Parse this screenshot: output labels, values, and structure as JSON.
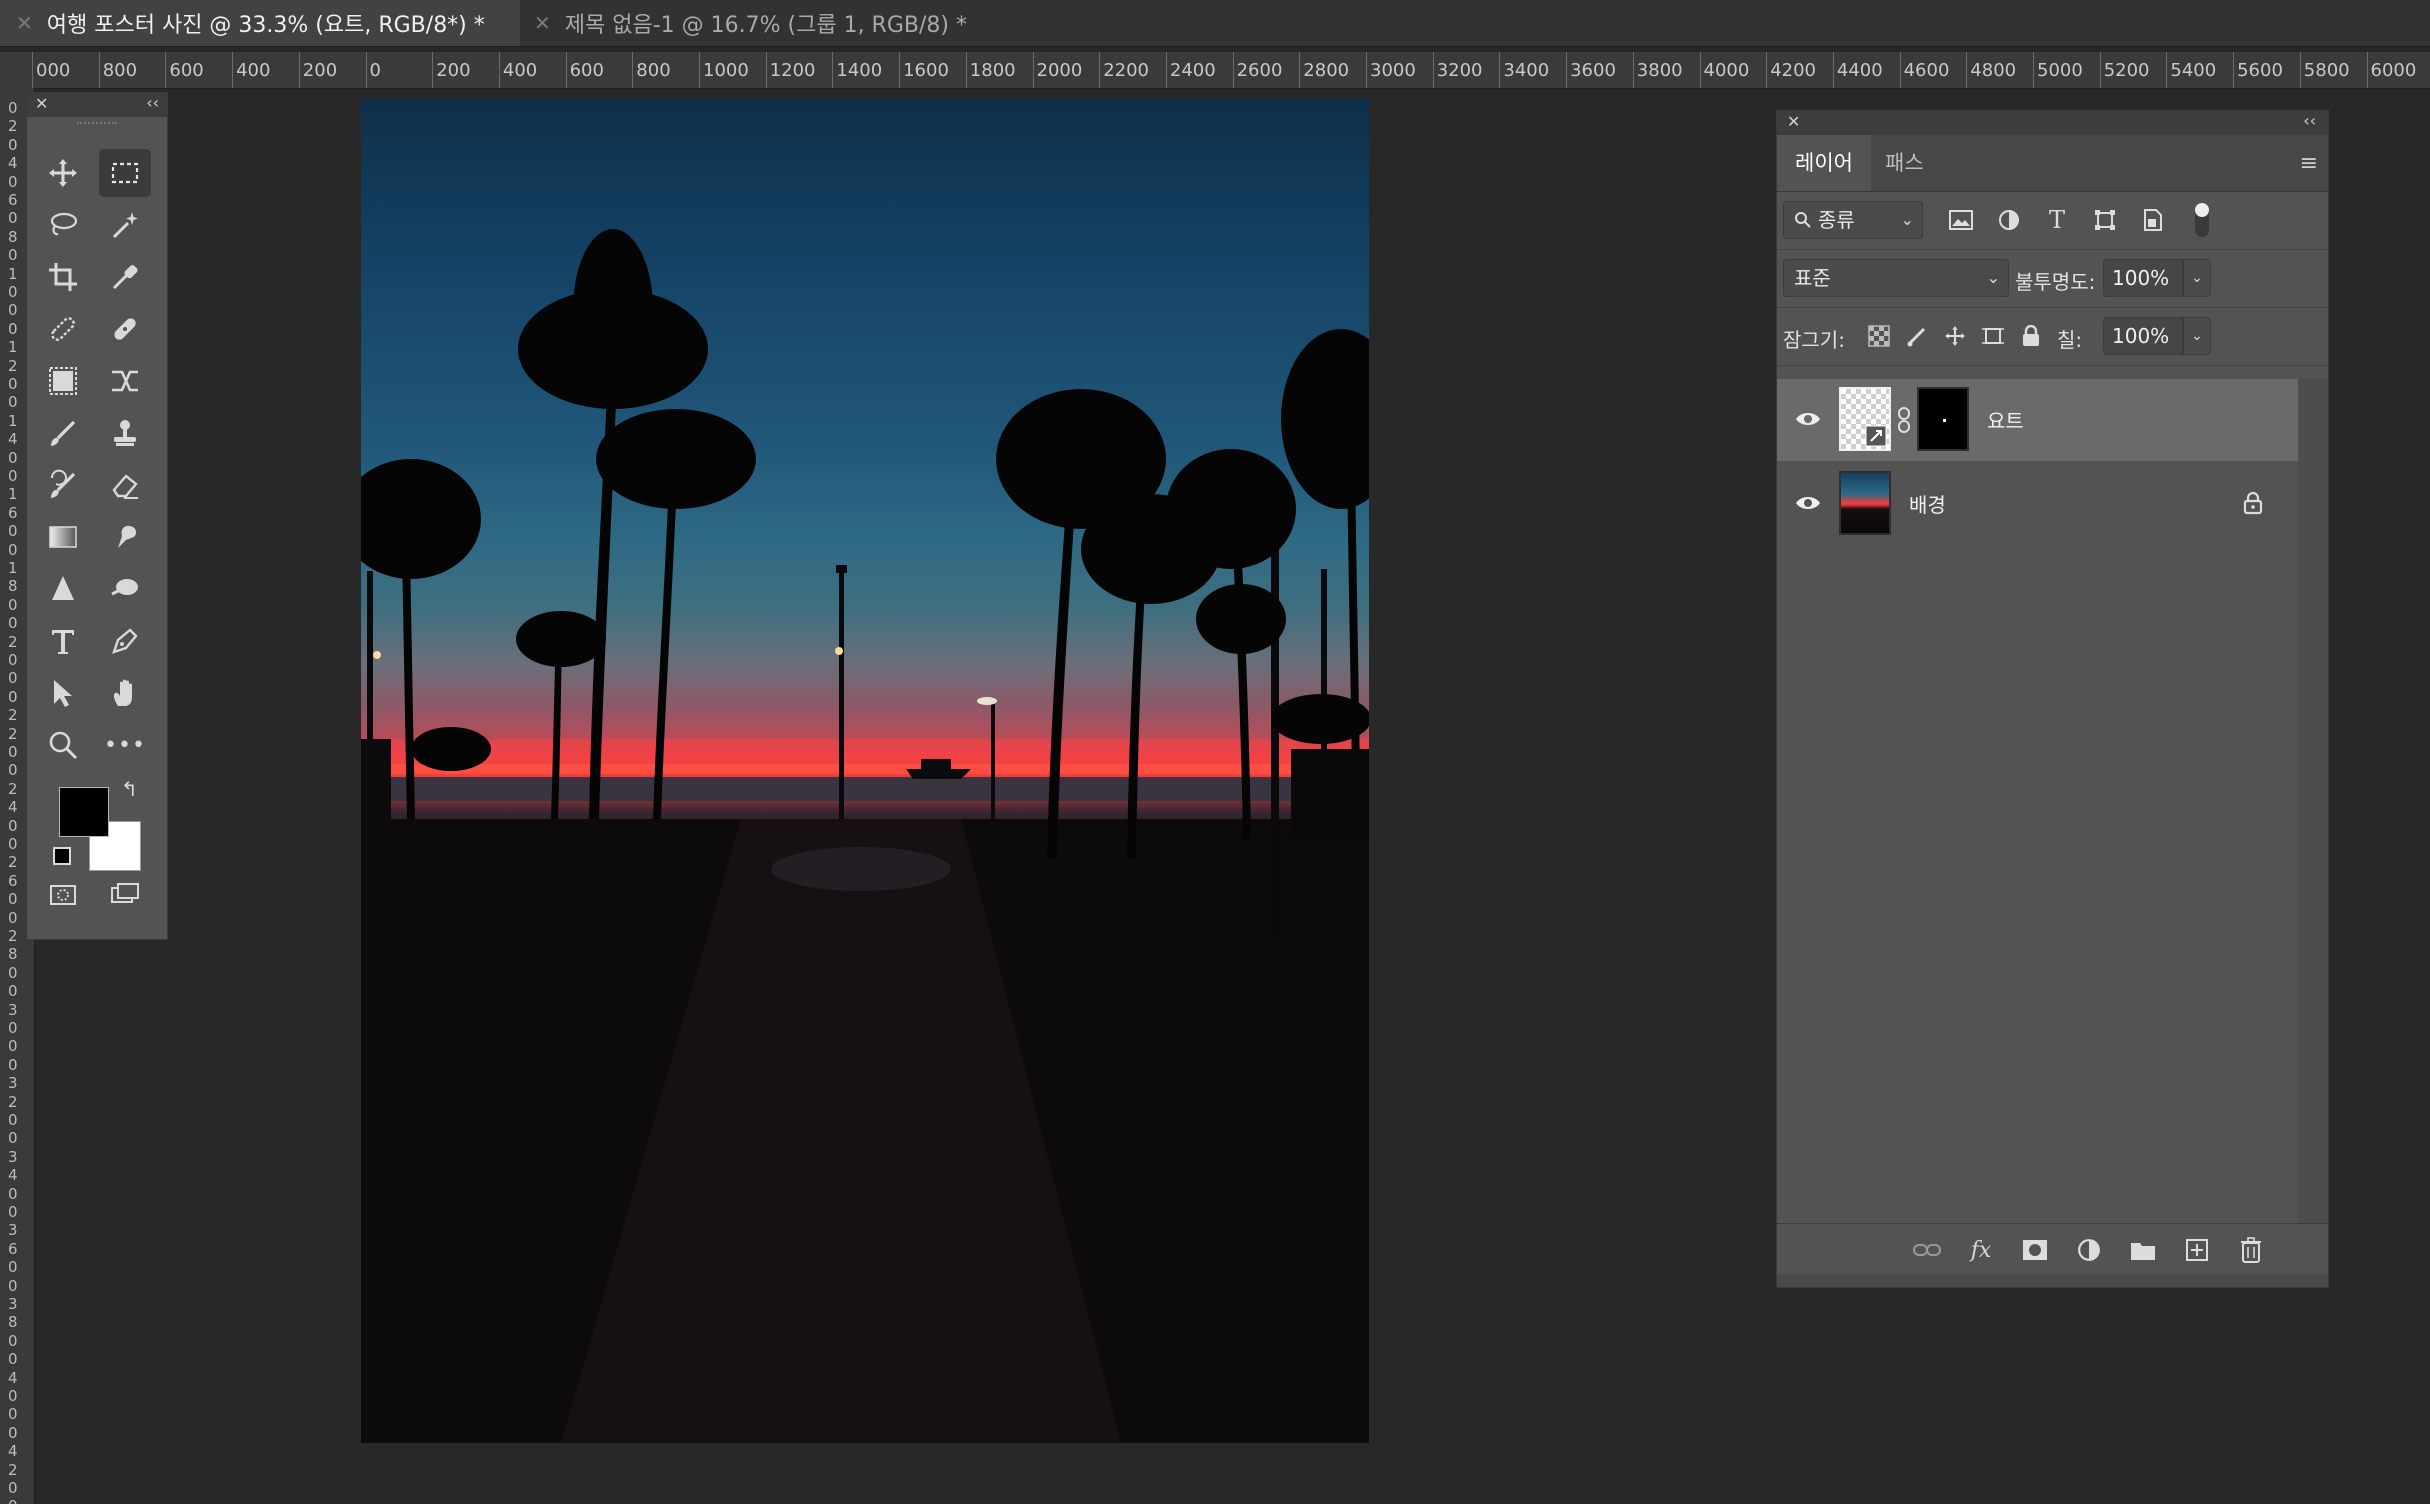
{
  "tabs": [
    {
      "close": "✕",
      "label": "여행 포스터 사진 @ 33.3% (요트, RGB/8*) *"
    },
    {
      "close": "✕",
      "label": "제목 없음-1 @ 16.7% (그룹 1, RGB/8) *"
    }
  ],
  "ruler": {
    "h_labels": [
      "000",
      "800",
      "600",
      "400",
      "200",
      "0",
      "200",
      "400",
      "600",
      "800",
      "1000",
      "1200",
      "1400",
      "1600",
      "1800",
      "2000",
      "2200",
      "2400",
      "2600",
      "2800",
      "3000",
      "3200",
      "3400",
      "3600",
      "3800",
      "4000",
      "4200",
      "4400",
      "4600",
      "4800",
      "5000",
      "5200",
      "5400",
      "5600",
      "5800",
      "6000"
    ],
    "v_labels": [
      "0",
      "2",
      "0",
      "4",
      "0",
      "6",
      "0",
      "8",
      "0",
      "1",
      "0",
      "0",
      "0",
      "1",
      "2",
      "0",
      "0",
      "1",
      "4",
      "0",
      "0",
      "1",
      "6",
      "0",
      "0",
      "1",
      "8",
      "0",
      "0",
      "2",
      "0",
      "0",
      "0",
      "2",
      "2",
      "0",
      "0",
      "2",
      "4",
      "0",
      "0",
      "2",
      "6",
      "0",
      "0",
      "2",
      "8",
      "0",
      "0",
      "3",
      "0",
      "0",
      "0",
      "3",
      "2",
      "0",
      "0",
      "3",
      "4",
      "0",
      "0",
      "3",
      "6",
      "0",
      "0",
      "3",
      "8",
      "0",
      "0",
      "4",
      "0",
      "0",
      "0",
      "4",
      "2",
      "0",
      "0"
    ]
  },
  "tools_panel": {
    "close": "✕",
    "collapse": "‹‹",
    "tools": [
      "move-tool",
      "rectangular-marquee-tool",
      "lasso-tool",
      "magic-wand-tool",
      "crop-tool",
      "eyedropper-tool",
      "spot-healing-tool",
      "healing-brush-tool",
      "object-selection-tool",
      "content-aware-move-tool",
      "brush-tool",
      "clone-stamp-tool",
      "history-brush-tool",
      "eraser-tool",
      "gradient-tool",
      "smudge-tool",
      "blur-tool",
      "dodge-tool",
      "type-tool",
      "pen-tool",
      "path-selection-tool",
      "hand-tool",
      "zoom-tool",
      "more-tools",
      "foreground-color",
      "background-color",
      "quick-mask",
      "screen-mode"
    ],
    "more_glyph": "•••",
    "swap_glyph": "↰",
    "foreground_color": "#000000",
    "background_color": "#ffffff"
  },
  "layers_panel": {
    "close": "✕",
    "collapse": "‹‹",
    "tabs": [
      "레이어",
      "패스"
    ],
    "menu_glyph": "≡",
    "filter_kind": "종류",
    "blend_mode": "표준",
    "opacity_label": "불투명도:",
    "opacity_value": "100%",
    "lock_label": "잠그기:",
    "fill_label": "칠:",
    "fill_value": "100%",
    "layers": [
      {
        "name": "요트",
        "visible": true,
        "selected": true,
        "has_mask": true
      },
      {
        "name": "배경",
        "visible": true,
        "selected": false,
        "locked": true
      }
    ],
    "bottom_icons": [
      "link-layers-icon",
      "fx-icon",
      "add-mask-icon",
      "adjustment-layer-icon",
      "new-group-icon",
      "new-layer-icon",
      "delete-layer-icon"
    ],
    "fx_label": "fx"
  },
  "colors": {
    "app_bg": "#282828",
    "panel_bg": "#535353",
    "selected_layer_bg": "#6a6a6a",
    "sunset_red": "#ff3b3b"
  }
}
